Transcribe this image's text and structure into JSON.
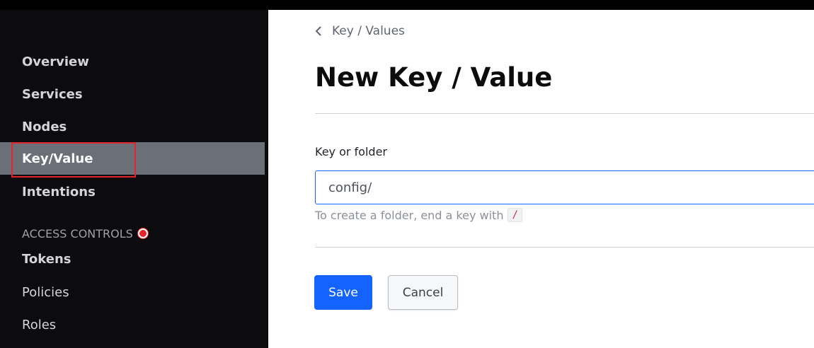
{
  "sidebar": {
    "items": [
      {
        "label": "Overview"
      },
      {
        "label": "Services"
      },
      {
        "label": "Nodes"
      },
      {
        "label": "Key/Value",
        "active": true
      },
      {
        "label": "Intentions"
      }
    ],
    "access_controls": {
      "heading": "ACCESS CONTROLS",
      "badge_color": "#e3242b",
      "items": [
        {
          "label": "Tokens"
        },
        {
          "label": "Policies"
        },
        {
          "label": "Roles"
        }
      ]
    }
  },
  "main": {
    "breadcrumb": {
      "icon": "chevron-left-icon",
      "label": "Key / Values"
    },
    "title": "New Key / Value",
    "form": {
      "label": "Key or folder",
      "value": "config/",
      "help_text": "To create a folder, end a key with",
      "help_code": "/"
    },
    "actions": {
      "save_label": "Save",
      "cancel_label": "Cancel"
    }
  },
  "colors": {
    "accent": "#1563ff",
    "sidebar_bg": "#0c0c0e",
    "active_item_bg": "#6b6f78",
    "highlight_border": "#e3242b"
  }
}
